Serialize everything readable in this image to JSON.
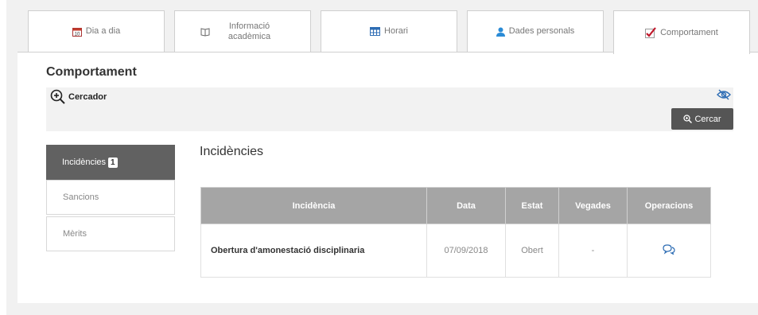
{
  "tabs": [
    {
      "label": "Dia a dia",
      "icon": "calendar-icon"
    },
    {
      "label": "Informació acadèmica",
      "icon": "book-icon"
    },
    {
      "label": "Horari",
      "icon": "schedule-icon"
    },
    {
      "label": "Dades personals",
      "icon": "user-icon"
    },
    {
      "label": "Comportament",
      "icon": "check-icon",
      "active": true
    }
  ],
  "page_title": "Comportament",
  "search": {
    "label": "Cercador",
    "button_label": "Cercar"
  },
  "sidebar": {
    "items": [
      {
        "label": "Incidències",
        "badge": "1",
        "active": true
      },
      {
        "label": "Sancions"
      },
      {
        "label": "Mèrits"
      }
    ]
  },
  "section_title": "Incidències",
  "table": {
    "headers": [
      "Incidència",
      "Data",
      "Estat",
      "Vegades",
      "Operacions"
    ],
    "rows": [
      {
        "incidencia": "Obertura d'amonestació disciplinaria",
        "data": "07/09/2018",
        "estat": "Obert",
        "vegades": "-",
        "operacions_icon": "comments-icon"
      }
    ]
  },
  "colors": {
    "accent": "#616161",
    "check": "#c0172a",
    "header_bg": "#a5a5a5"
  }
}
